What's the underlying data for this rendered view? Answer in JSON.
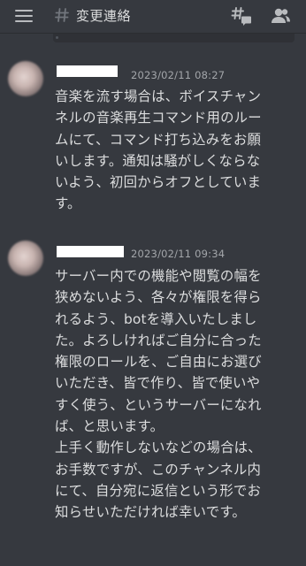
{
  "header": {
    "channel_name": "変更連絡",
    "menu_icon": "hamburger-menu-icon",
    "hash_icon": "text-channel-hash-icon",
    "threads_icon": "threads-icon",
    "members_icon": "members-icon"
  },
  "colors": {
    "background": "#36393f",
    "text": "#dcddde",
    "muted": "#a3a6aa",
    "username_redaction": "#ffffff"
  },
  "messages": [
    {
      "author": "",
      "timestamp": "2023/02/11 08:27",
      "content": "音楽を流す場合は、ボイスチャン\nネルの音楽再生コマンド用のルー\nムにて、コマンド打ち込みをお願\nいします。通知は騒がしくならな\nいよう、初回からオフとしていま\nす。"
    },
    {
      "author": "",
      "timestamp": "2023/02/11 09:34",
      "content": "サーバー内での機能や閲覧の幅を\n狭めないよう、各々が権限を得ら\nれるよう、botを導入いたしまし\nた。よろしければご自分に合った\n権限のロールを、ご自由にお選び\nいただき、皆で作り、皆で使いや\nすく使う、というサーバーになれ\nば、と思います。\n上手く動作しないなどの場合は、\nお手数ですが、このチャンネル内\nにて、自分宛に返信という形でお\n知らせいただければ幸いです。"
    }
  ]
}
